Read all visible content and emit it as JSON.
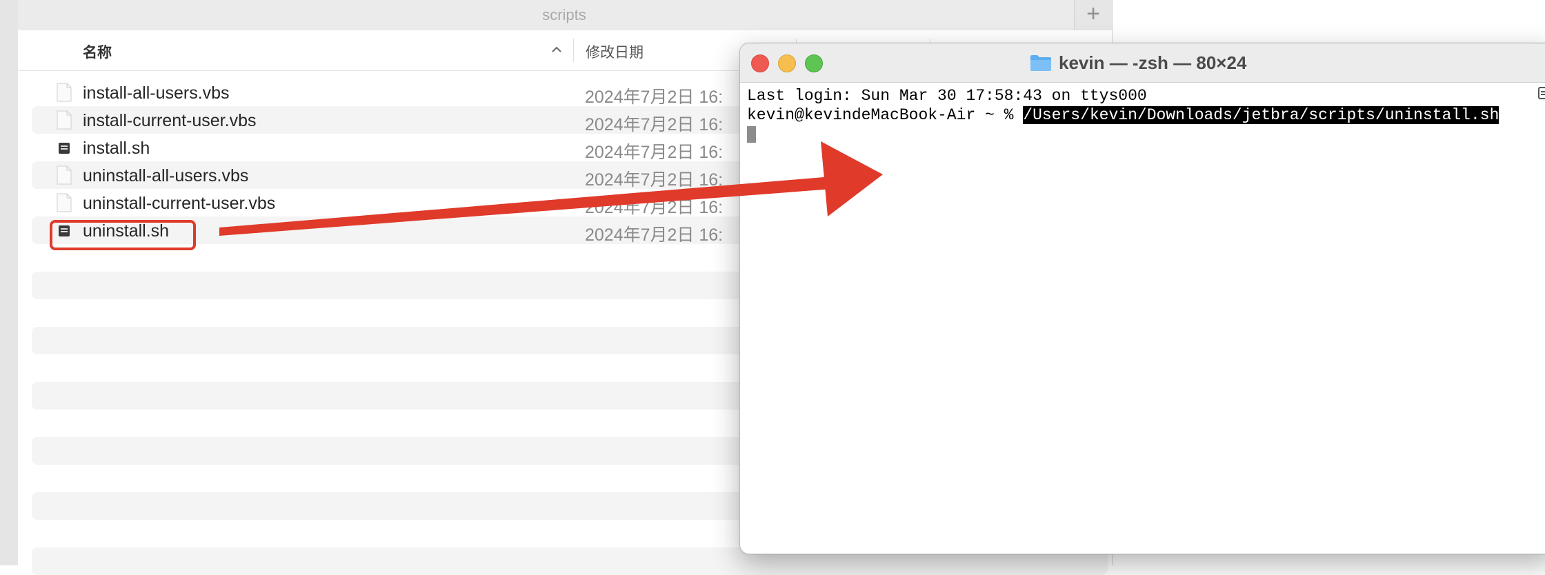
{
  "finder": {
    "window_title": "scripts",
    "new_tab_symbol": "+",
    "columns": {
      "name": "名称",
      "date_modified": "修改日期"
    },
    "files": [
      {
        "name": "install-all-users.vbs",
        "date": "2024年7月2日 16:",
        "icon": "document-icon"
      },
      {
        "name": "install-current-user.vbs",
        "date": "2024年7月2日 16:",
        "icon": "document-icon"
      },
      {
        "name": "install.sh",
        "date": "2024年7月2日 16:",
        "icon": "script-icon"
      },
      {
        "name": "uninstall-all-users.vbs",
        "date": "2024年7月2日 16:",
        "icon": "document-icon"
      },
      {
        "name": "uninstall-current-user.vbs",
        "date": "2024年7月2日 16:",
        "icon": "document-icon"
      },
      {
        "name": "uninstall.sh",
        "date": "2024年7月2日 16:",
        "icon": "script-icon",
        "highlighted": true
      }
    ]
  },
  "terminal": {
    "title": "kevin — -zsh — 80×24",
    "lines": {
      "last_login": "Last login: Sun Mar 30 17:58:43 on ttys000",
      "prompt": "kevin@kevindeMacBook-Air ~ % ",
      "command": "/Users/kevin/Downloads/jetbra/scripts/uninstall.sh"
    }
  },
  "annotation": {
    "arrow_color": "#e03a2a",
    "highlight_color": "#e03a2a"
  }
}
